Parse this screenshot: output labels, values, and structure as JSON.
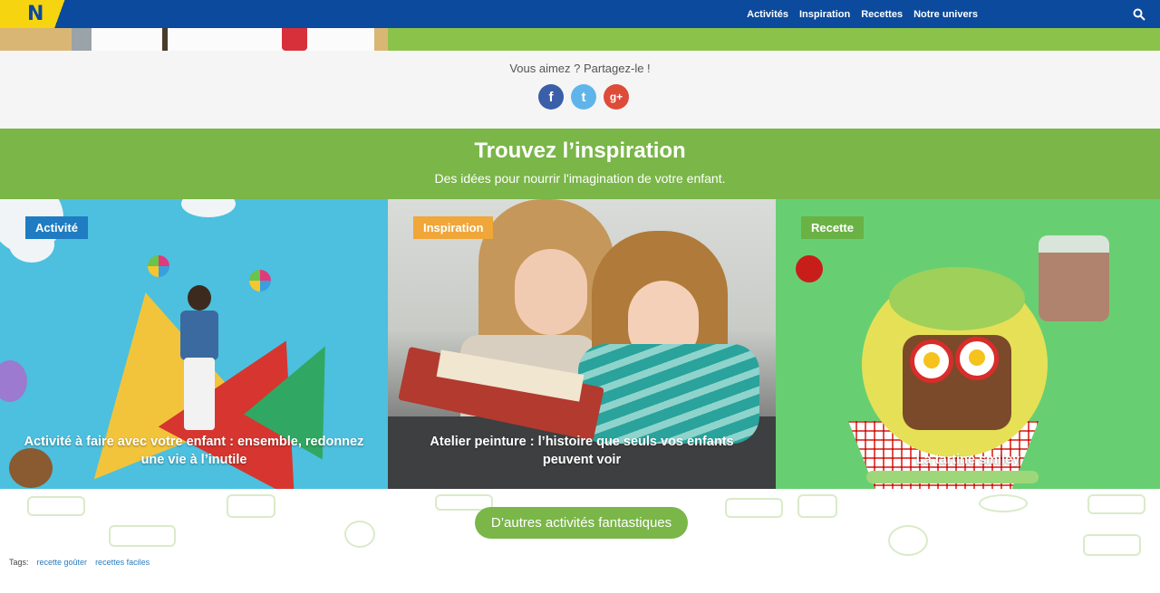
{
  "nav": {
    "logo_letter": "N",
    "links": [
      "Activités",
      "Inspiration",
      "Recettes",
      "Notre univers"
    ]
  },
  "share": {
    "title": "Vous aimez ? Partagez-le !",
    "facebook": "f",
    "twitter": "t",
    "googleplus": "g+"
  },
  "banner": {
    "title": "Trouvez l’inspiration",
    "subtitle": "Des idées pour nourrir l'imagination de votre enfant."
  },
  "cards": [
    {
      "tag": "Activité",
      "title": "Activité à faire avec votre enfant : ensemble, redonnez une vie à l’inutile"
    },
    {
      "tag": "Inspiration",
      "title": "Atelier peinture : l’histoire que seuls vos enfants peuvent voir"
    },
    {
      "tag": "Recette",
      "title": "La tartine smiley"
    }
  ],
  "more_button": "D’autres activités fantastiques",
  "tags": {
    "label": "Tags:",
    "items": [
      "recette goûter",
      "recettes faciles"
    ]
  },
  "colors": {
    "nav": "#0b4a9c",
    "green": "#7ab648",
    "tag_activite": "#1f7cc2",
    "tag_inspiration": "#f0a638",
    "tag_recette": "#6ab245"
  }
}
